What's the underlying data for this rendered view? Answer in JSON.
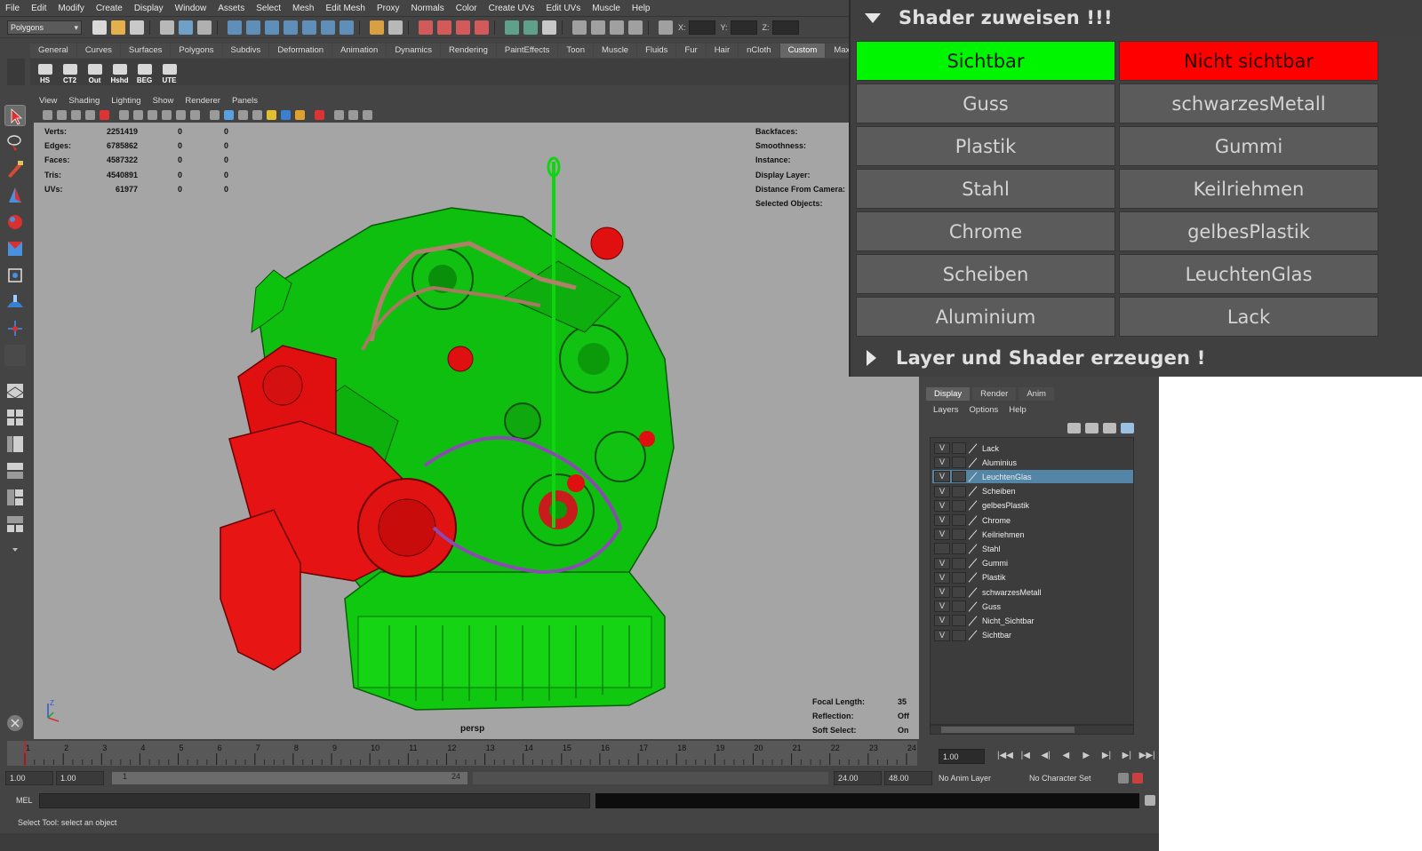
{
  "menubar": [
    "File",
    "Edit",
    "Modify",
    "Create",
    "Display",
    "Window",
    "Assets",
    "Select",
    "Mesh",
    "Edit Mesh",
    "Proxy",
    "Normals",
    "Color",
    "Create UVs",
    "Edit UVs",
    "Muscle",
    "Help"
  ],
  "statusline": {
    "mode": "Polygons",
    "x_label": "X:",
    "y_label": "Y:",
    "z_label": "Z:"
  },
  "shelf": {
    "tabs": [
      "General",
      "Curves",
      "Surfaces",
      "Polygons",
      "Subdivs",
      "Deformation",
      "Animation",
      "Dynamics",
      "Rendering",
      "PaintEffects",
      "Toon",
      "Muscle",
      "Fluids",
      "Fur",
      "Hair",
      "nCloth",
      "Custom",
      "Maxwell"
    ],
    "active_tab": "Custom",
    "buttons": [
      "HS",
      "CT2",
      "Out",
      "Hshd",
      "BEG",
      "UTE"
    ]
  },
  "viewport": {
    "menu": [
      "View",
      "Shading",
      "Lighting",
      "Show",
      "Renderer",
      "Panels"
    ],
    "hud_left": [
      {
        "label": "Verts:",
        "value": "2251419",
        "sel": "0",
        "comp": "0"
      },
      {
        "label": "Edges:",
        "value": "6785862",
        "sel": "0",
        "comp": "0"
      },
      {
        "label": "Faces:",
        "value": "4587322",
        "sel": "0",
        "comp": "0"
      },
      {
        "label": "Tris:",
        "value": "4540891",
        "sel": "0",
        "comp": "0"
      },
      {
        "label": "UVs:",
        "value": "61977",
        "sel": "0",
        "comp": "0"
      }
    ],
    "hud_right": [
      "Backfaces:",
      "Smoothness:",
      "Instance:",
      "Display Layer:",
      "Distance From Camera:",
      "Selected Objects:"
    ],
    "hud_bottom": [
      {
        "label": "Focal Length:",
        "value": "35"
      },
      {
        "label": "Reflection:",
        "value": "Off"
      },
      {
        "label": "Soft Select:",
        "value": "On"
      }
    ],
    "camera": "persp",
    "gizmo_axis": "Z",
    "colors": {
      "background": "#a5a5a5",
      "green": "#0ec40e",
      "red": "#e00f0f"
    }
  },
  "timeline": {
    "ticks": [
      "1",
      "2",
      "3",
      "4",
      "5",
      "6",
      "7",
      "8",
      "9",
      "10",
      "11",
      "12",
      "13",
      "14",
      "15",
      "16",
      "17",
      "18",
      "19",
      "20",
      "21",
      "22",
      "23",
      "24"
    ],
    "current_frame": "1.00",
    "range_start": "1.00",
    "playback_start": "1.00",
    "slider_left": "1",
    "slider_right": "24",
    "playback_end": "24.00",
    "range_end": "48.00",
    "anim_layer": "No Anim Layer",
    "character_set": "No Character Set"
  },
  "mel": {
    "label": "MEL"
  },
  "helpline": "Select Tool: select an object",
  "layer_editor": {
    "tabs": [
      "Display",
      "Render",
      "Anim"
    ],
    "active_tab": "Display",
    "menu": [
      "Layers",
      "Options",
      "Help"
    ],
    "layers": [
      {
        "name": "Lack",
        "v": "V"
      },
      {
        "name": "Aluminius",
        "v": "V"
      },
      {
        "name": "LeuchtenGlas",
        "v": "V",
        "selected": true
      },
      {
        "name": "Scheiben",
        "v": "V"
      },
      {
        "name": "gelbesPlastik",
        "v": "V"
      },
      {
        "name": "Chrome",
        "v": "V"
      },
      {
        "name": "Keilriehmen",
        "v": "V"
      },
      {
        "name": "Stahl",
        "v": ""
      },
      {
        "name": "Gummi",
        "v": "V"
      },
      {
        "name": "Plastik",
        "v": "V"
      },
      {
        "name": "schwarzesMetall",
        "v": "V"
      },
      {
        "name": "Guss",
        "v": "V"
      },
      {
        "name": "Nicht_Sichtbar",
        "v": "V"
      },
      {
        "name": "Sichtbar",
        "v": "V"
      }
    ]
  },
  "shader_window": {
    "section1_title": "Shader zuweisen !!!",
    "section2_title": "Layer und Shader erzeugen !",
    "buttons": [
      {
        "label": "Sichtbar",
        "color": "#00f500"
      },
      {
        "label": "Nicht sichtbar",
        "color": "#ff0000"
      },
      {
        "label": "Guss"
      },
      {
        "label": "schwarzesMetall"
      },
      {
        "label": "Plastik"
      },
      {
        "label": "Gummi"
      },
      {
        "label": "Stahl"
      },
      {
        "label": "Keilriehmen"
      },
      {
        "label": "Chrome"
      },
      {
        "label": "gelbesPlastik"
      },
      {
        "label": "Scheiben"
      },
      {
        "label": "LeuchtenGlas"
      },
      {
        "label": "Aluminium"
      },
      {
        "label": "Lack"
      }
    ]
  }
}
